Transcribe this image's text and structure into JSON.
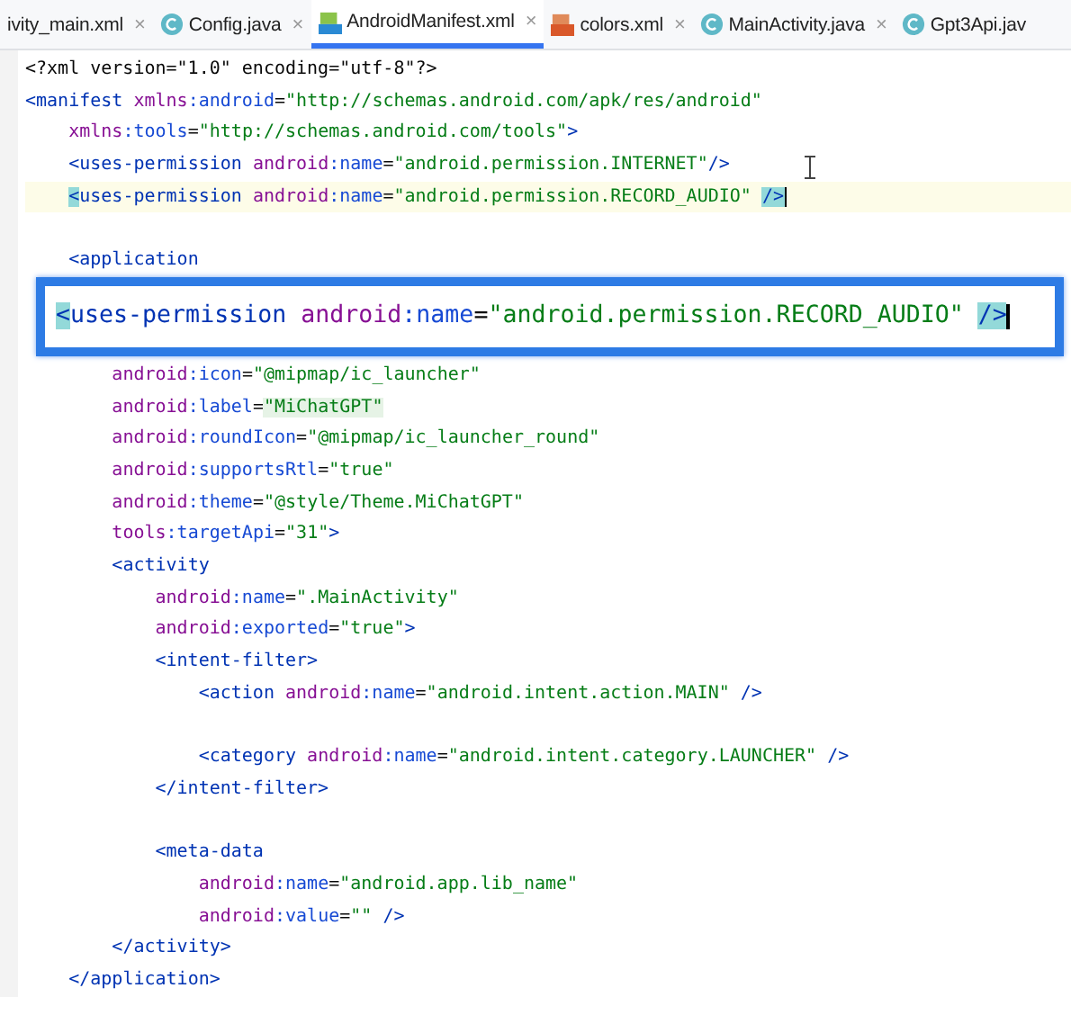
{
  "tabs": [
    {
      "label": "ivity_main.xml",
      "kind": "cut",
      "selected": false,
      "close": "×"
    },
    {
      "label": "Config.java",
      "kind": "java",
      "selected": false,
      "close": "×"
    },
    {
      "label": "AndroidManifest.xml",
      "kind": "manifest",
      "selected": true,
      "close": "×"
    },
    {
      "label": "colors.xml",
      "kind": "resource",
      "selected": false,
      "close": "×"
    },
    {
      "label": "MainActivity.java",
      "kind": "java",
      "selected": false,
      "close": "×"
    },
    {
      "label": "Gpt3Api.jav",
      "kind": "java",
      "selected": false
    }
  ],
  "editor": {
    "lines_before": [
      {
        "current": false,
        "tokens": [
          {
            "kind": "plain",
            "text": "<?xml version=\"1.0\" encoding=\"utf-8\"?>"
          }
        ]
      },
      {
        "current": false,
        "tokens": [
          {
            "kind": "tag",
            "text": "<manifest "
          },
          {
            "kind": "ns",
            "text": "xmlns"
          },
          {
            "kind": "attr",
            "text": ":android"
          },
          {
            "kind": "plain",
            "text": "="
          },
          {
            "kind": "val",
            "text": "\"http://schemas.android.com/apk/res/android\""
          }
        ]
      },
      {
        "current": false,
        "tokens": [
          {
            "kind": "ns",
            "text": "    xmlns"
          },
          {
            "kind": "attr",
            "text": ":tools"
          },
          {
            "kind": "plain",
            "text": "="
          },
          {
            "kind": "val",
            "text": "\"http://schemas.android.com/tools\""
          },
          {
            "kind": "tag",
            "text": ">"
          }
        ]
      },
      {
        "current": false,
        "tokens": [
          {
            "kind": "tag",
            "text": "    <uses-permission "
          },
          {
            "kind": "ns",
            "text": "android"
          },
          {
            "kind": "attr",
            "text": ":name"
          },
          {
            "kind": "plain",
            "text": "="
          },
          {
            "kind": "val",
            "text": "\"android.permission.INTERNET\""
          },
          {
            "kind": "tag",
            "text": "/>"
          }
        ]
      },
      {
        "current": true,
        "tokens": [
          {
            "kind": "match",
            "text": "    <"
          },
          {
            "kind": "tag",
            "text": "uses-permission "
          },
          {
            "kind": "ns",
            "text": "android"
          },
          {
            "kind": "attr",
            "text": ":name"
          },
          {
            "kind": "plain",
            "text": "="
          },
          {
            "kind": "val",
            "text": "\"android.permission.RECORD_AUDIO\" "
          },
          {
            "kind": "match",
            "text": "/>"
          }
        ]
      },
      {
        "current": false
      },
      {
        "current": false,
        "tokens": [
          {
            "kind": "tag",
            "text": "    <application"
          }
        ]
      }
    ],
    "popup": {
      "tokens": [
        {
          "kind": "match",
          "text": "<"
        },
        {
          "kind": "tag",
          "text": "uses-permission "
        },
        {
          "kind": "ns",
          "text": "android"
        },
        {
          "kind": "attr",
          "text": ":name"
        },
        {
          "kind": "plain",
          "text": "="
        },
        {
          "kind": "val",
          "text": "\"android.permission.RECORD_AUDIO\" "
        },
        {
          "kind": "match",
          "text": "/>"
        }
      ]
    },
    "lines_after": [
      {
        "current": false,
        "tokens": [
          {
            "kind": "ns",
            "text": "        android"
          },
          {
            "kind": "attr",
            "text": ":icon"
          },
          {
            "kind": "plain",
            "text": "="
          },
          {
            "kind": "val",
            "text": "\"@mipmap/ic_launcher\""
          }
        ]
      },
      {
        "current": false,
        "tokens": [
          {
            "kind": "ns",
            "text": "        android"
          },
          {
            "kind": "attr",
            "text": ":label"
          },
          {
            "kind": "plain",
            "text": "="
          },
          {
            "kind": "valhl",
            "text": "\"MiChatGPT\""
          }
        ]
      },
      {
        "current": false,
        "tokens": [
          {
            "kind": "ns",
            "text": "        android"
          },
          {
            "kind": "attr",
            "text": ":roundIcon"
          },
          {
            "kind": "plain",
            "text": "="
          },
          {
            "kind": "val",
            "text": "\"@mipmap/ic_launcher_round\""
          }
        ]
      },
      {
        "current": false,
        "tokens": [
          {
            "kind": "ns",
            "text": "        android"
          },
          {
            "kind": "attr",
            "text": ":supportsRtl"
          },
          {
            "kind": "plain",
            "text": "="
          },
          {
            "kind": "val",
            "text": "\"true\""
          }
        ]
      },
      {
        "current": false,
        "tokens": [
          {
            "kind": "ns",
            "text": "        android"
          },
          {
            "kind": "attr",
            "text": ":theme"
          },
          {
            "kind": "plain",
            "text": "="
          },
          {
            "kind": "val",
            "text": "\"@style/Theme.MiChatGPT\""
          }
        ]
      },
      {
        "current": false,
        "tokens": [
          {
            "kind": "ns",
            "text": "        tools"
          },
          {
            "kind": "attr",
            "text": ":targetApi"
          },
          {
            "kind": "plain",
            "text": "="
          },
          {
            "kind": "val",
            "text": "\"31\""
          },
          {
            "kind": "tag",
            "text": ">"
          }
        ]
      },
      {
        "current": false,
        "tokens": [
          {
            "kind": "tag",
            "text": "        <activity"
          }
        ]
      },
      {
        "current": false,
        "tokens": [
          {
            "kind": "ns",
            "text": "            android"
          },
          {
            "kind": "attr",
            "text": ":name"
          },
          {
            "kind": "plain",
            "text": "="
          },
          {
            "kind": "val",
            "text": "\".MainActivity\""
          }
        ]
      },
      {
        "current": false,
        "tokens": [
          {
            "kind": "ns",
            "text": "            android"
          },
          {
            "kind": "attr",
            "text": ":exported"
          },
          {
            "kind": "plain",
            "text": "="
          },
          {
            "kind": "val",
            "text": "\"true\""
          },
          {
            "kind": "tag",
            "text": ">"
          }
        ]
      },
      {
        "current": false,
        "tokens": [
          {
            "kind": "tag",
            "text": "            <intent-filter>"
          }
        ]
      },
      {
        "current": false,
        "tokens": [
          {
            "kind": "tag",
            "text": "                <action "
          },
          {
            "kind": "ns",
            "text": "android"
          },
          {
            "kind": "attr",
            "text": ":name"
          },
          {
            "kind": "plain",
            "text": "="
          },
          {
            "kind": "val",
            "text": "\"android.intent.action.MAIN\" "
          },
          {
            "kind": "tag",
            "text": "/>"
          }
        ]
      },
      {
        "current": false
      },
      {
        "current": false,
        "tokens": [
          {
            "kind": "tag",
            "text": "                <category "
          },
          {
            "kind": "ns",
            "text": "android"
          },
          {
            "kind": "attr",
            "text": ":name"
          },
          {
            "kind": "plain",
            "text": "="
          },
          {
            "kind": "val",
            "text": "\"android.intent.category.LAUNCHER\" "
          },
          {
            "kind": "tag",
            "text": "/>"
          }
        ]
      },
      {
        "current": false,
        "tokens": [
          {
            "kind": "tag",
            "text": "            </intent-filter>"
          }
        ]
      },
      {
        "current": false
      },
      {
        "current": false,
        "tokens": [
          {
            "kind": "tag",
            "text": "            <meta-data"
          }
        ]
      },
      {
        "current": false,
        "tokens": [
          {
            "kind": "ns",
            "text": "                android"
          },
          {
            "kind": "attr",
            "text": ":name"
          },
          {
            "kind": "plain",
            "text": "="
          },
          {
            "kind": "val",
            "text": "\"android.app.lib_name\""
          }
        ]
      },
      {
        "current": false,
        "tokens": [
          {
            "kind": "ns",
            "text": "                android"
          },
          {
            "kind": "attr",
            "text": ":value"
          },
          {
            "kind": "plain",
            "text": "="
          },
          {
            "kind": "val",
            "text": "\"\" "
          },
          {
            "kind": "tag",
            "text": "/>"
          }
        ]
      },
      {
        "current": false,
        "tokens": [
          {
            "kind": "tag",
            "text": "        </activity>"
          }
        ]
      },
      {
        "current": false,
        "tokens": [
          {
            "kind": "tag",
            "text": "    </application>"
          }
        ]
      }
    ]
  }
}
